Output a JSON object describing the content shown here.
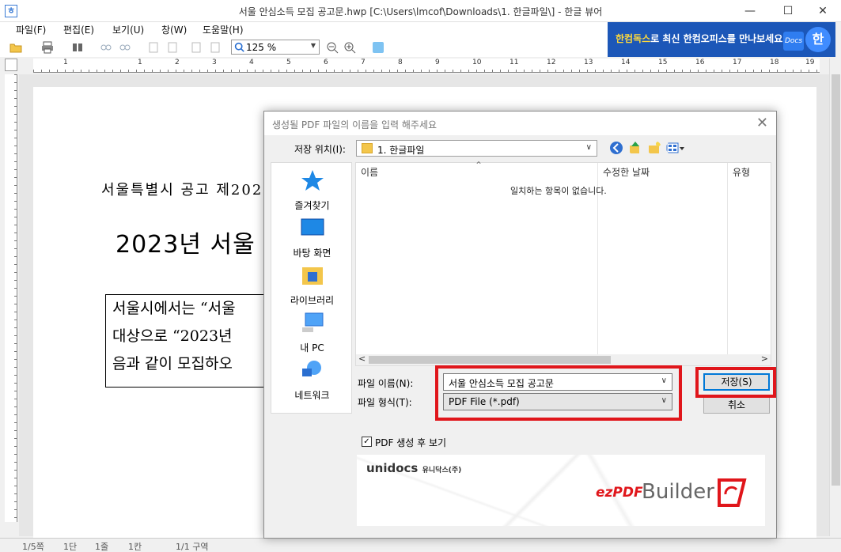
{
  "window": {
    "title": "서울 안심소득 모집 공고문.hwp [C:\\Users\\lmcof\\Downloads\\1. 한글파일\\] - 한글 뷰어",
    "app_icon": "ㅎ",
    "minimize": "—",
    "maximize": "☐",
    "close": "✕"
  },
  "menu": [
    "파일(F)",
    "편집(E)",
    "보기(U)",
    "창(W)",
    "도움말(H)"
  ],
  "toolbar": {
    "zoom": "125 %"
  },
  "banner": {
    "highlight": "한컴독스",
    "text": "로 최신 한컴오피스를 만나보세요",
    "docs": "Docs",
    "han": "한"
  },
  "ruler": [
    "1",
    "1",
    "2",
    "3",
    "4",
    "5",
    "6",
    "7",
    "8",
    "9",
    "10",
    "11",
    "12",
    "13",
    "14",
    "15",
    "16",
    "17",
    "18",
    "19"
  ],
  "document": {
    "line1": "서울특별시 공고 제202",
    "title": "2023년 서울",
    "box_lines": [
      "서울시에서는 “서울",
      "대상으로 “2023년",
      "음과 같이 모집하오"
    ]
  },
  "status": [
    "1/5쪽",
    "1단",
    "1줄",
    "1칸",
    "1/1 구역"
  ],
  "dialog": {
    "title": "생성될 PDF 파일의 이름을 입력 해주세요",
    "close": "✕",
    "save_in_label": "저장 위치(I):",
    "save_in_value": "1. 한글파일",
    "places": [
      "즐겨찾기",
      "바탕 화면",
      "라이브러리",
      "내 PC",
      "네트워크"
    ],
    "columns": [
      "이름",
      "수정한 날짜",
      "유형"
    ],
    "empty_message": "일치하는 항목이 없습니다.",
    "filename_label": "파일 이름(N):",
    "filename_value": "서울 안심소득 모집 공고문",
    "filetype_label": "파일 형식(T):",
    "filetype_value": "PDF File (*.pdf)",
    "save_button": "저장(S)",
    "cancel_button": "취소",
    "view_after_label": "PDF 생성 후 보기",
    "brand": "unidocs",
    "brand_kr": "유니닥스(주)",
    "product_ez": "ezPDF",
    "product_builder": "Builder"
  },
  "colors": {
    "highlight_red": "#e0161b",
    "banner_blue": "#1c57b8",
    "banner_yellow": "#ffd93b"
  }
}
